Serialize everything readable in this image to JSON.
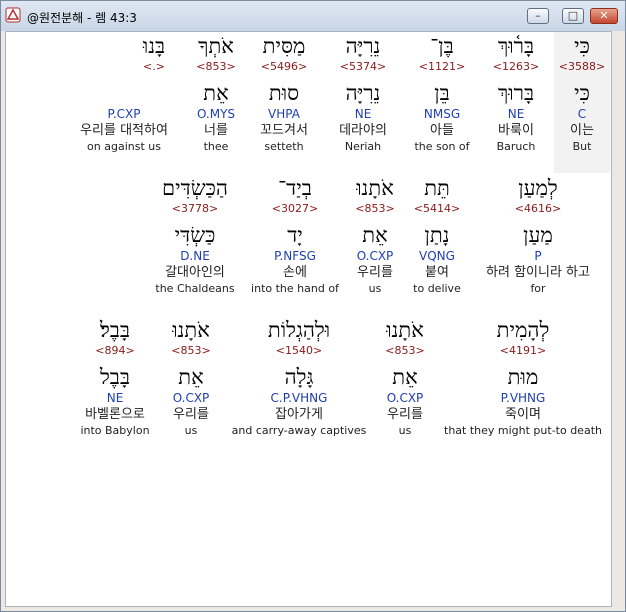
{
  "window": {
    "title": "@원전분해 - 렘 43:3",
    "buttons": {
      "minimize": "–",
      "maximize": "□",
      "close": "✕"
    }
  },
  "rows": [
    [
      {
        "heb": "כִּי",
        "strong": "<3588>",
        "lex": "כִּי",
        "morph": "C",
        "kor": "이는",
        "eng": "But",
        "selected": true
      },
      {
        "heb": "בָּר֫וּךְ",
        "strong": "<1263>",
        "lex": "בָּרוּךְ",
        "morph": "NE",
        "kor": "바룩이",
        "eng": "Baruch"
      },
      {
        "heb": "בֶּן־",
        "strong": "<1121>",
        "lex": "בֵּן",
        "morph": "NMSG",
        "kor": "아들",
        "eng": "the son of"
      },
      {
        "heb": "נֵרִיָּה",
        "strong": "<5374>",
        "lex": "נֵרִיָּה",
        "morph": "NE",
        "kor": "데라야의",
        "eng": "Neriah"
      },
      {
        "heb": "מַסִּית",
        "strong": "<5496>",
        "lex": "סוּת",
        "morph": "VHPA",
        "kor": "꼬드겨서",
        "eng": "setteth"
      },
      {
        "heb": "אֹתְךָ",
        "strong": "<853>",
        "lex": "אֵת",
        "morph": "O.MYS",
        "kor": "너를",
        "eng": "thee"
      },
      {
        "heb": "בָּנוּ",
        "strong": "<.>",
        "lex": "",
        "morph": "P.CXP",
        "kor": "우리를 대적하여",
        "eng": "on against us"
      }
    ],
    [
      {
        "heb": "לְמַעַן",
        "strong": "<4616>",
        "lex": "מַעַן",
        "morph": "P",
        "kor": "하려 함이니라 하고",
        "eng": "for"
      },
      {
        "heb": "תֵּת",
        "strong": "<5414>",
        "lex": "נָתַן",
        "morph": "VQNG",
        "kor": "붙여",
        "eng": "to delive"
      },
      {
        "heb": "אֹתָנוּ",
        "strong": "<853>",
        "lex": "אֵת",
        "morph": "O.CXP",
        "kor": "우리를",
        "eng": "us"
      },
      {
        "heb": "בְיַד־",
        "strong": "<3027>",
        "lex": "יָד",
        "morph": "P.NFSG",
        "kor": "손에",
        "eng": "into the hand of"
      },
      {
        "heb": "הַכַּשְׂדִּים",
        "strong": "<3778>",
        "lex": "כַּשְׂדִּי",
        "morph": "D.NE",
        "kor": "갈대아인의",
        "eng": "the Chaldeans"
      }
    ],
    [
      {
        "heb": "לְהָמִית",
        "strong": "<4191>",
        "lex": "מוּת",
        "morph": "P.VHNG",
        "kor": "죽이며",
        "eng": "that they might put-to death"
      },
      {
        "heb": "אֹתָנוּ",
        "strong": "<853>",
        "lex": "אֵת",
        "morph": "O.CXP",
        "kor": "우리를",
        "eng": "us"
      },
      {
        "heb": "וּלְהַגְלוֹת",
        "strong": "<1540>",
        "lex": "גָּלָה",
        "morph": "C.P.VHNG",
        "kor": "잡아가게",
        "eng": "and carry-away captives"
      },
      {
        "heb": "אֹתָנוּ",
        "strong": "<853>",
        "lex": "אֵת",
        "morph": "O.CXP",
        "kor": "우리를",
        "eng": "us"
      },
      {
        "heb": "בָּבֶל׃",
        "strong": "<894>",
        "lex": "בָּבֶל",
        "morph": "NE",
        "kor": "바벨론으로",
        "eng": "into Babylon"
      }
    ]
  ]
}
